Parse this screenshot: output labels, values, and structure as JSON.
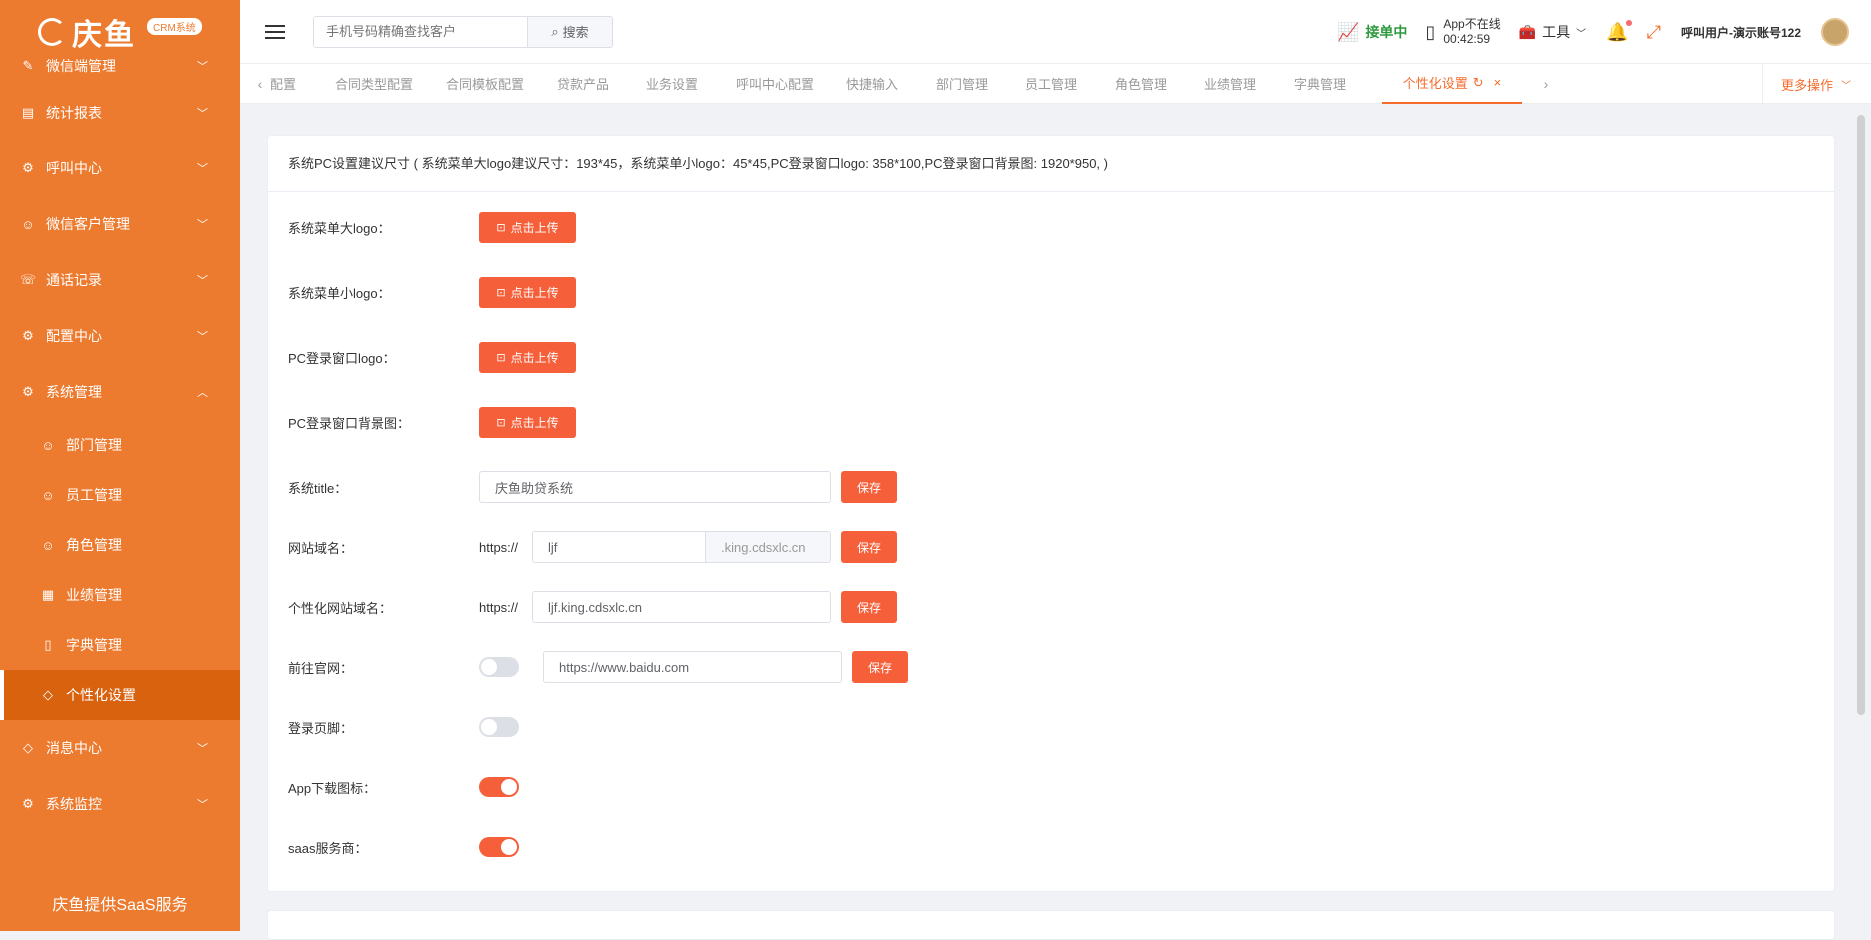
{
  "sidebar": {
    "brand": "庆鱼",
    "badge": "CRM系统",
    "items": [
      {
        "label": "微信端管理",
        "icon": "edit-icon"
      },
      {
        "label": "统计报表",
        "icon": "table-icon"
      },
      {
        "label": "呼叫中心",
        "icon": "gear-icon"
      },
      {
        "label": "微信客户管理",
        "icon": "user-icon"
      },
      {
        "label": "通话记录",
        "icon": "phone-icon"
      },
      {
        "label": "配置中心",
        "icon": "gear-icon"
      },
      {
        "label": "系统管理",
        "icon": "gear-icon"
      }
    ],
    "sub_items": [
      {
        "label": "部门管理",
        "icon": "user-icon"
      },
      {
        "label": "员工管理",
        "icon": "user-icon"
      },
      {
        "label": "角色管理",
        "icon": "user-icon"
      },
      {
        "label": "业绩管理",
        "icon": "grid-icon"
      },
      {
        "label": "字典管理",
        "icon": "book-icon"
      },
      {
        "label": "个性化设置",
        "icon": "diamond-icon"
      }
    ],
    "items_after": [
      {
        "label": "消息中心",
        "icon": "diamond-icon"
      },
      {
        "label": "系统监控",
        "icon": "gear-icon"
      }
    ],
    "footer": "庆鱼提供SaaS服务"
  },
  "header": {
    "search_placeholder": "手机号码精确查找客户",
    "search_label": "搜索",
    "status": "接单中",
    "app_status": "App不在线",
    "app_time": "00:42:59",
    "tools": "工具",
    "user": "呼叫用户-演示账号122"
  },
  "tabs": {
    "items": [
      "配置",
      "合同类型配置",
      "合同模板配置",
      "贷款产品",
      "业务设置",
      "呼叫中心配置",
      "快捷输入",
      "部门管理",
      "员工管理",
      "角色管理",
      "业绩管理",
      "字典管理"
    ],
    "active": "个性化设置",
    "more": "更多操作"
  },
  "main": {
    "header": "系统PC设置建议尺寸 ( 系统菜单大logo建议尺寸：193*45，系统菜单小logo：45*45,PC登录窗口logo: 358*100,PC登录窗口背景图: 1920*950, )",
    "upload_label": "点击上传",
    "save_label": "保存",
    "rows": {
      "big_logo": "系统菜单大logo：",
      "small_logo": "系统菜单小logo：",
      "pc_logo": "PC登录窗口logo：",
      "pc_bg": "PC登录窗口背景图：",
      "title": "系统title：",
      "title_value": "庆鱼助贷系统",
      "domain": "网站域名：",
      "domain_prefix": "https://",
      "domain_value": "ljf",
      "domain_suffix": ".king.cdsxlc.cn",
      "custom_domain": "个性化网站域名：",
      "custom_domain_prefix": "https://",
      "custom_domain_value": "ljf.king.cdsxlc.cn",
      "website": "前往官网：",
      "website_value": "https://www.baidu.com",
      "footer": "登录页脚：",
      "app_icon": "App下载图标：",
      "saas": "saas服务商："
    },
    "switches": {
      "website": false,
      "footer": false,
      "app_icon": true,
      "saas": true
    }
  }
}
